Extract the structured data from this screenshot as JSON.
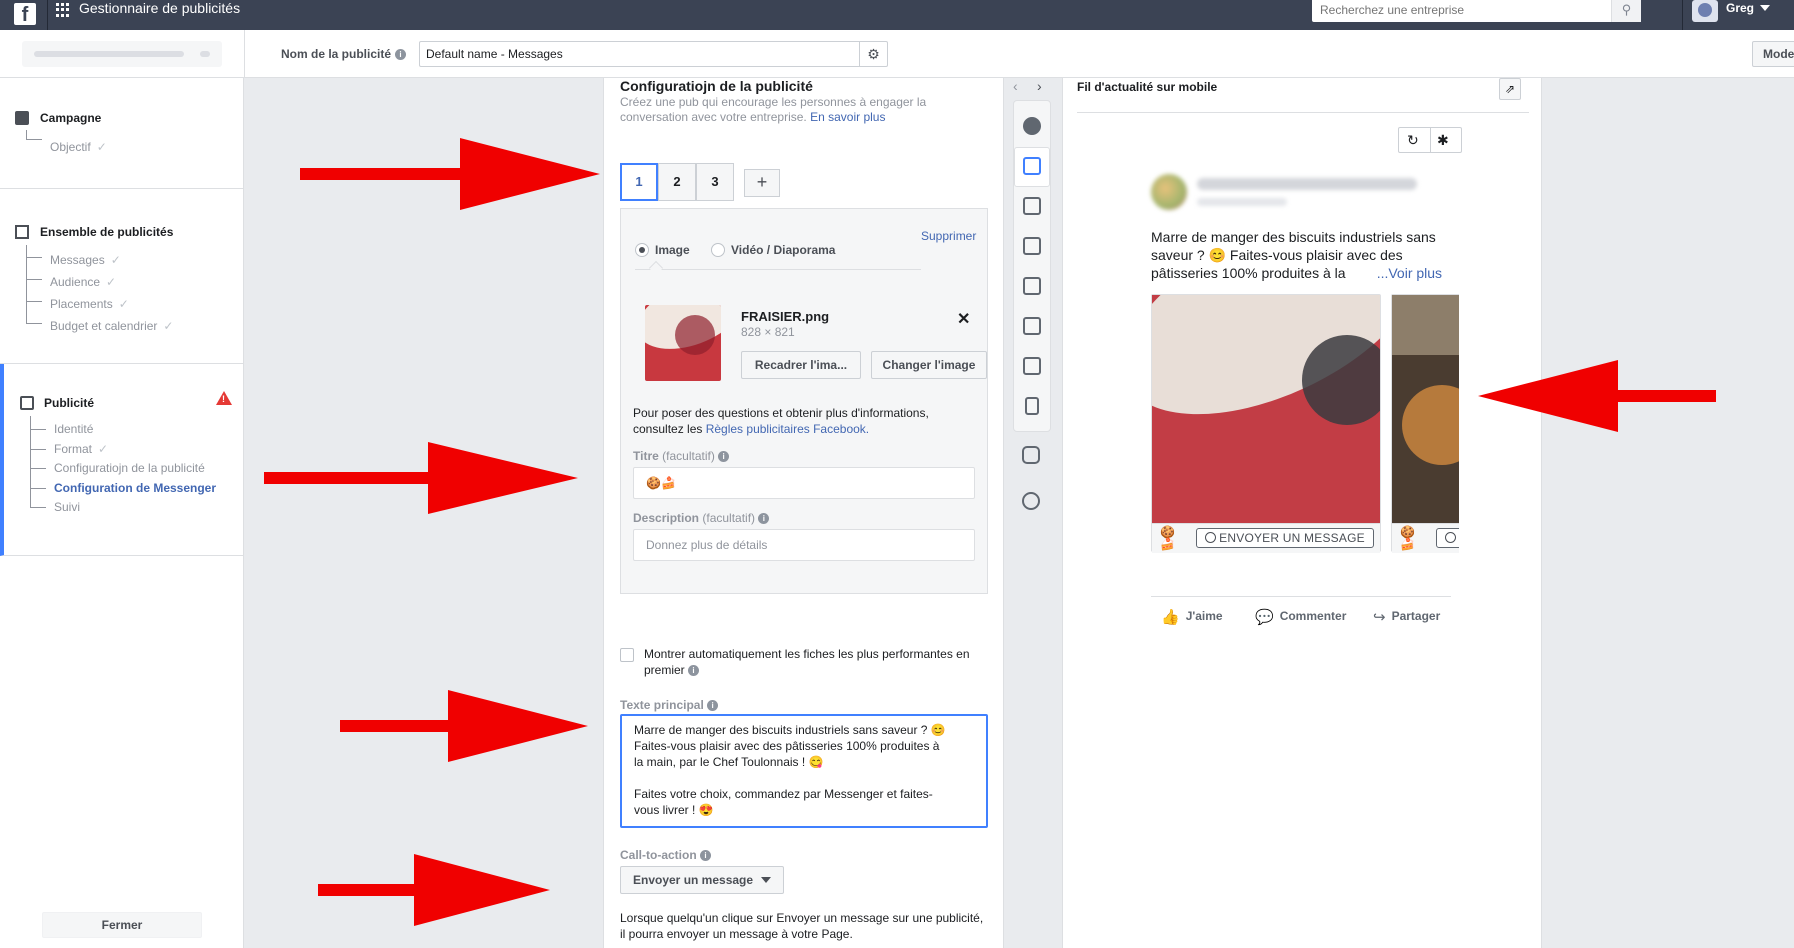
{
  "topbar": {
    "logo": "f",
    "app_title": "Gestionnaire de publicités",
    "search_placeholder": "Recherchez une entreprise",
    "user_name": "Greg"
  },
  "subheader": {
    "ad_name_label": "Nom de la publicité",
    "ad_name_value": "Default name - Messages",
    "mode_button": "Mode"
  },
  "leftnav": {
    "campaign": {
      "title": "Campagne",
      "items": [
        "Objectif"
      ]
    },
    "adset": {
      "title": "Ensemble de publicités",
      "items": [
        "Messages",
        "Audience",
        "Placements",
        "Budget et calendrier"
      ]
    },
    "ad": {
      "title": "Publicité",
      "items": [
        "Identité",
        "Format",
        "Configuratiojn de la publicité",
        "Configuration de Messenger",
        "Suivi"
      ],
      "current_index": 3
    },
    "close_button": "Fermer"
  },
  "config": {
    "title": "Configuratiojn de la publicité",
    "subtitle": "Créez une pub qui encourage les personnes à engager la conversation avec votre entreprise.",
    "learn_more": "En savoir plus",
    "cards": [
      "1",
      "2",
      "3"
    ],
    "add_card": "+",
    "delete_link": "Supprimer",
    "media_options": [
      "Image",
      "Vidéo / Diaporama"
    ],
    "file_name": "FRAISIER.png",
    "file_dims": "828 × 821",
    "crop_button": "Recadrer l'ima...",
    "change_image_button": "Changer l'image",
    "policy_text": "Pour poser des questions et obtenir plus d'informations, consultez les ",
    "policy_link": "Règles publicitaires Facebook.",
    "title_label": "Titre",
    "title_optional": "(facultatif)",
    "title_value": "🍪🍰",
    "description_label": "Description",
    "description_optional": "(facultatif)",
    "description_placeholder": "Donnez plus de détails",
    "auto_show_label": "Montrer automatiquement les fiches les plus performantes en premier",
    "primary_text_label": "Texte principal",
    "primary_text_value": "Marre de manger des biscuits industriels sans saveur ? 😊\nFaites-vous plaisir avec des pâtisseries 100% produites à\nla main, par le Chef Toulonnais ! 😋\n\nFaites votre choix, commandez par Messenger et faites-\nvous livrer ! 😍",
    "cta_label": "Call-to-action",
    "cta_value": "Envoyer un message",
    "cta_help": "Lorsque quelqu'un clique sur Envoyer un message sur une publicité, il pourra envoyer un message à votre Page."
  },
  "preview": {
    "title": "Fil d'actualité sur mobile",
    "post_text": "Marre de manger des biscuits industriels sans saveur ? 😊 Faites-vous plaisir avec des pâtisseries 100% produites à la",
    "see_more": "...Voir plus",
    "card_emoji": "🍪🍰",
    "cta_button": "ENVOYER UN MESSAGE",
    "actions": {
      "like": "J'aime",
      "comment": "Commenter",
      "share": "Partager"
    }
  },
  "colors": {
    "accent": "#4080ff",
    "topbar": "#3b4354",
    "arrow": "#f00000",
    "warning": "#e53935"
  }
}
